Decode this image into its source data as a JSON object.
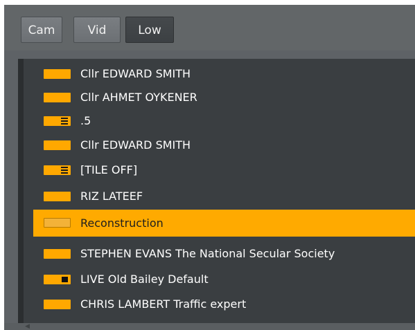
{
  "toolbar": {
    "buttons": [
      {
        "label": "Cam",
        "active": false
      },
      {
        "label": "Vid",
        "active": false
      },
      {
        "label": "Low",
        "active": true
      }
    ]
  },
  "list": {
    "items": [
      {
        "label": "Cllr EDWARD SMITH",
        "icon": "plain"
      },
      {
        "label": "Cllr AHMET OYKENER",
        "icon": "plain"
      },
      {
        "label": ".5",
        "icon": "lines"
      },
      {
        "label": "Cllr EDWARD SMITH",
        "icon": "plain"
      },
      {
        "label": "[TILE OFF]",
        "icon": "lines"
      },
      {
        "label": "RIZ LATEEF",
        "icon": "plain"
      },
      {
        "label": "Reconstruction",
        "icon": "plain",
        "selected": true
      },
      {
        "label": "STEPHEN EVANS The National Secular Society",
        "icon": "plain"
      },
      {
        "label": "LIVE Old Bailey Default",
        "icon": "block"
      },
      {
        "label": "CHRIS LAMBERT Traffic expert",
        "icon": "plain"
      }
    ]
  },
  "colors": {
    "accent": "#ffaa00",
    "panel": "#5e6266",
    "list_bg": "#3a3e41"
  }
}
